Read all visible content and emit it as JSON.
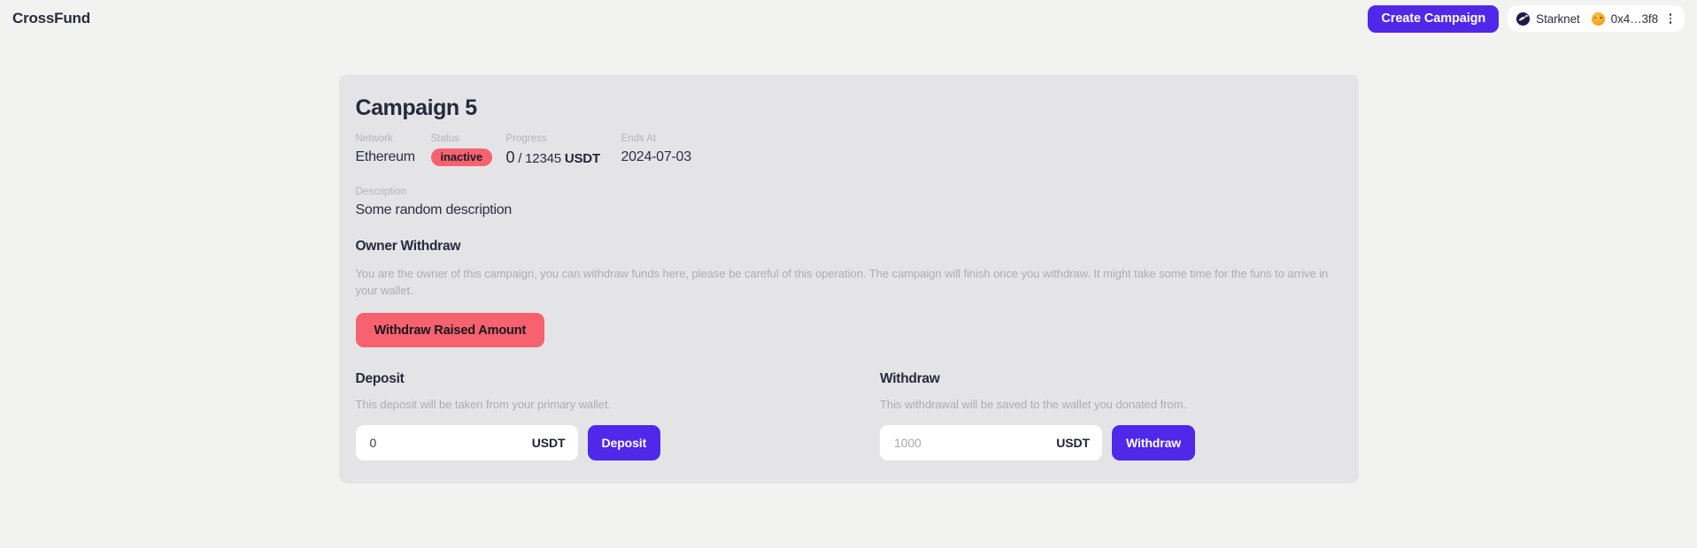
{
  "header": {
    "brand": "CrossFund",
    "create_campaign_label": "Create Campaign",
    "chain": {
      "name": "Starknet",
      "icon": "starknet-logo-icon"
    },
    "account": {
      "address": "0x4…3f8",
      "avatar_icon": "account-avatar-icon",
      "menu_icon": "kebab-menu-icon"
    },
    "accent_color": "#4f28ea"
  },
  "campaign": {
    "title": "Campaign 5",
    "meta": {
      "network_label": "Network",
      "network_value": "Ethereum",
      "status_label": "Status",
      "status_value": "inactive",
      "status_color": "#f8626f",
      "progress_label": "Progress",
      "progress_current": "0",
      "progress_total": "/ 12345",
      "progress_unit": "USDT",
      "ends_at_label": "Ends At",
      "ends_at_value": "2024-07-03"
    },
    "description_label": "Description",
    "description_value": "Some random description"
  },
  "owner_withdraw": {
    "heading": "Owner Withdraw",
    "paragraph": "You are the owner of this campaign, you can withdraw funds here, please be careful of this operation. The campaign will finish once you withdraw. It might take some time for the funs to arrive in your wallet.",
    "button_label": "Withdraw Raised Amount",
    "button_color": "#f8626f"
  },
  "deposit": {
    "heading": "Deposit",
    "description": "This deposit will be taken from your primary wallet.",
    "input_value": "0",
    "input_placeholder": "0",
    "unit": "USDT",
    "button_label": "Deposit"
  },
  "withdraw": {
    "heading": "Withdraw",
    "description": "This withdrawal will be saved to the wallet you donated from.",
    "input_value": "",
    "input_placeholder": "1000",
    "unit": "USDT",
    "button_label": "Withdraw"
  }
}
